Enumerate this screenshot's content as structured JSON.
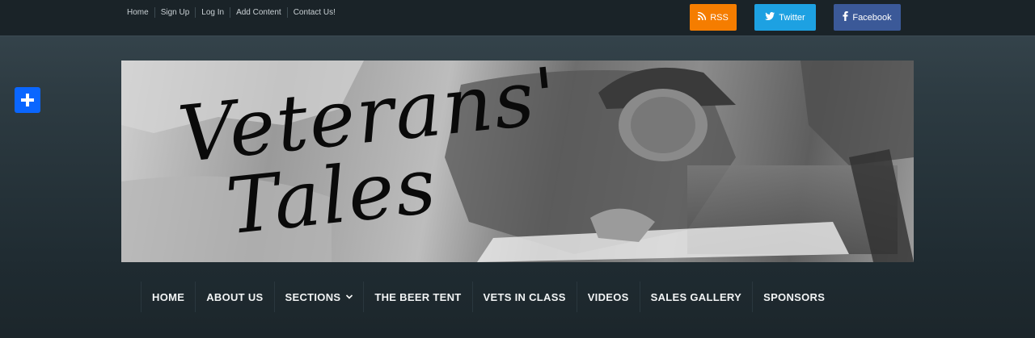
{
  "top_links": [
    "Home",
    "Sign Up",
    "Log In",
    "Add Content",
    "Contact Us!"
  ],
  "social": {
    "rss": "RSS",
    "twitter": "Twitter",
    "facebook": "Facebook"
  },
  "banner": {
    "line1": "Veterans'",
    "line2": "Tales"
  },
  "nav": [
    "HOME",
    "ABOUT US",
    "SECTIONS",
    "THE BEER TENT",
    "VETS IN CLASS",
    "VIDEOS",
    "SALES GALLERY",
    "SPONSORS"
  ],
  "colors": {
    "rss": "#f57d00",
    "twitter": "#1da1e2",
    "facebook": "#3b5998",
    "share": "#0a66ff"
  },
  "icons": [
    "rss-icon",
    "twitter-icon",
    "facebook-icon",
    "share-plus-icon",
    "chevron-down-icon"
  ]
}
